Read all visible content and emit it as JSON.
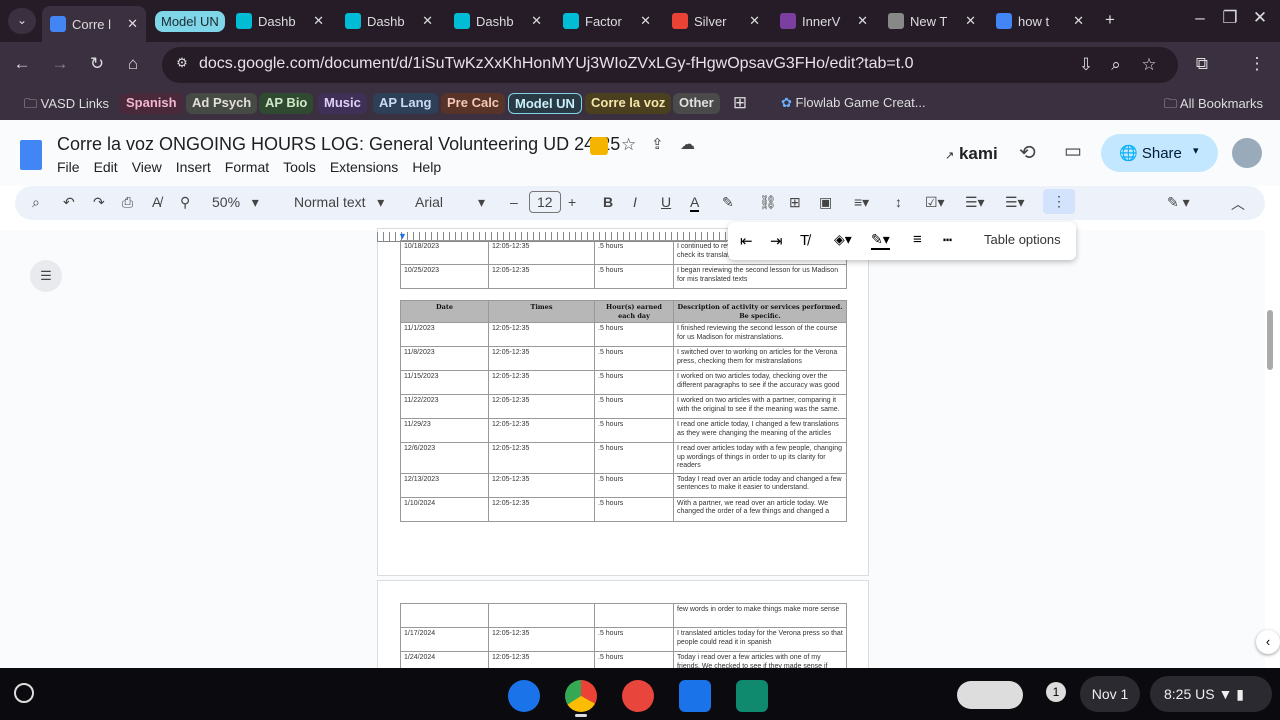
{
  "browser": {
    "tabs": [
      {
        "label": "Corre l",
        "icon": "docs-icon",
        "active": true
      },
      {
        "label": "Dashb",
        "icon": "b-icon"
      },
      {
        "label": "Dashb",
        "icon": "b-icon"
      },
      {
        "label": "Dashb",
        "icon": "b-icon"
      },
      {
        "label": "Factor",
        "icon": "b-icon"
      },
      {
        "label": "Silver",
        "icon": "gmail-icon"
      },
      {
        "label": "InnerV",
        "icon": "innerv-icon"
      },
      {
        "label": "New T",
        "icon": "chrome-icon"
      },
      {
        "label": "how t",
        "icon": "google-icon"
      }
    ],
    "tab_group": "Model UN",
    "url": "docs.google.com/document/d/1iSuTwKzXxKhHonMYUj3WIoZVxLGy-fHgwOpsavG3FHo/edit?tab=t.0",
    "bookmarks": [
      {
        "label": "VASD Links"
      },
      {
        "label": "Spanish",
        "color": "#f3b6cf",
        "bg": "#4a2a3a"
      },
      {
        "label": "Ad Psych",
        "color": "#e0e0d8",
        "bg": "#464a44"
      },
      {
        "label": "AP Bio",
        "color": "#cfe8c8",
        "bg": "#2f4a30"
      },
      {
        "label": "Music",
        "color": "#e2cff5",
        "bg": "#3f3058"
      },
      {
        "label": "AP Lang",
        "color": "#c8dcf5",
        "bg": "#2e3f58"
      },
      {
        "label": "Pre Calc",
        "color": "#f5c8b8",
        "bg": "#583428"
      },
      {
        "label": "Model UN",
        "color": "#c8f0f8",
        "bg": "#2a3a44"
      },
      {
        "label": "Corre la voz",
        "color": "#f5e6a8",
        "bg": "#4a4020"
      },
      {
        "label": "Other",
        "color": "#e0e0e0",
        "bg": "#4a4a4a"
      }
    ],
    "flowlab": "Flowlab Game Creat...",
    "all_bookmarks": "All Bookmarks"
  },
  "docs": {
    "title": "Corre la voz  ONGOING HOURS LOG: General Volunteering UD 24-25",
    "menu": [
      "File",
      "Edit",
      "View",
      "Insert",
      "Format",
      "Tools",
      "Extensions",
      "Help"
    ],
    "kami": "kami",
    "share": "Share",
    "zoom": "50%",
    "style": "Normal text",
    "font": "Arial",
    "font_size": "12",
    "table_options": "Table options"
  },
  "table_top": [
    [
      "10/18/2023",
      "12:05-12:35",
      ".5 hours",
      "I continued to review the course for us Madison to check its translations"
    ],
    [
      "10/25/2023",
      "12:05-12:35",
      ".5 hours",
      "I began reviewing the second lesson for us Madison for mis translated texts"
    ]
  ],
  "table_headers": [
    "Date",
    "Times",
    "Hour(s) earned each day",
    "Description of activity or services performed. Be specific."
  ],
  "table_main": [
    [
      "11/1/2023",
      "12:05-12:35",
      ".5 hours",
      "I finished reviewing the second lesson of the course for us Madison for mistranslations."
    ],
    [
      "11/8/2023",
      "12:05-12:35",
      ".5 hours",
      "I switched over to working on articles for the Verona press, checking them for mistranslations"
    ],
    [
      "11/15/2023",
      "12:05-12:35",
      ".5 hours",
      "I worked on two articles today, checking over the different paragraphs to see if the accuracy was good"
    ],
    [
      "11/22/2023",
      "12:05-12:35",
      ".5 hours",
      "I worked on two articles with a partner, comparing it with the original to see if the meaning was the same."
    ],
    [
      "11/29/23",
      "12:05-12:35",
      ".5 hours",
      "I read one article today, I changed a few translations as they were changing the meaning of the articles"
    ],
    [
      "12/6/2023",
      "12:05-12:35",
      ".5 hours",
      "I read over articles today with a few people, changing up wordings of things in order to up its clarity for readers"
    ],
    [
      "12/13/2023",
      "12:05-12:35",
      ".5 hours",
      "Today I read over an article today and changed a few sentences to make it easier to understand."
    ],
    [
      "1/10/2024",
      "12:05-12:35",
      ".5 hours",
      "With a partner, we read over an article today. We changed the order of a few things and changed a"
    ]
  ],
  "table_next": [
    [
      "",
      "",
      "",
      "few words in order to make things make more sense"
    ],
    [
      "1/17/2024",
      "12:05-12:35",
      ".5 hours",
      "I translated articles today for the Verona press so that people could read it in spanish"
    ],
    [
      "1/24/2024",
      "12:05-12:35",
      ".5 hours",
      " Today i read over a few articles with one of my friends. We checked to see if they made sense if"
    ]
  ],
  "shelf": {
    "notification_count": "1",
    "date": "Nov 1",
    "time": "8:25",
    "locale": "US"
  }
}
